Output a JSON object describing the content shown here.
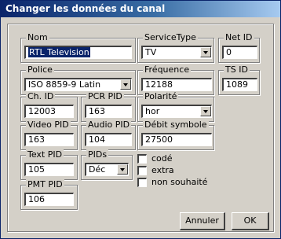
{
  "window": {
    "title": "Changer les données du canal"
  },
  "fields": {
    "nom": {
      "label": "Nom",
      "value": "RTL Television"
    },
    "service_type": {
      "label": "ServiceType",
      "value": "TV"
    },
    "net_id": {
      "label": "Net ID",
      "value": "0"
    },
    "police": {
      "label": "Police",
      "value": "ISO 8859-9 Latin"
    },
    "frequence": {
      "label": "Fréquence",
      "value": "12188"
    },
    "ts_id": {
      "label": "TS ID",
      "value": "1089"
    },
    "ch_id": {
      "label": "Ch. ID",
      "value": "12003"
    },
    "pcr_pid": {
      "label": "PCR PID",
      "value": "163"
    },
    "polarite": {
      "label": "Polarité",
      "value": "hor"
    },
    "video_pid": {
      "label": "Video PID",
      "value": "163"
    },
    "audio_pid": {
      "label": "Audio PID",
      "value": "104"
    },
    "debit_symbole": {
      "label": "Débit symbole",
      "value": "27500"
    },
    "text_pid": {
      "label": "Text PID",
      "value": "105"
    },
    "pids": {
      "label": "PIDs",
      "value": "Déc"
    },
    "pmt_pid": {
      "label": "PMT PID",
      "value": "106"
    }
  },
  "checkboxes": [
    {
      "label": "codé",
      "checked": false
    },
    {
      "label": "extra",
      "checked": false
    },
    {
      "label": "non souhaité",
      "checked": false
    }
  ],
  "buttons": {
    "cancel": "Annuler",
    "ok": "OK"
  },
  "colors": {
    "titlebar_start": "#0a246a",
    "titlebar_end": "#a6caf0",
    "face": "#d4d0c8"
  }
}
